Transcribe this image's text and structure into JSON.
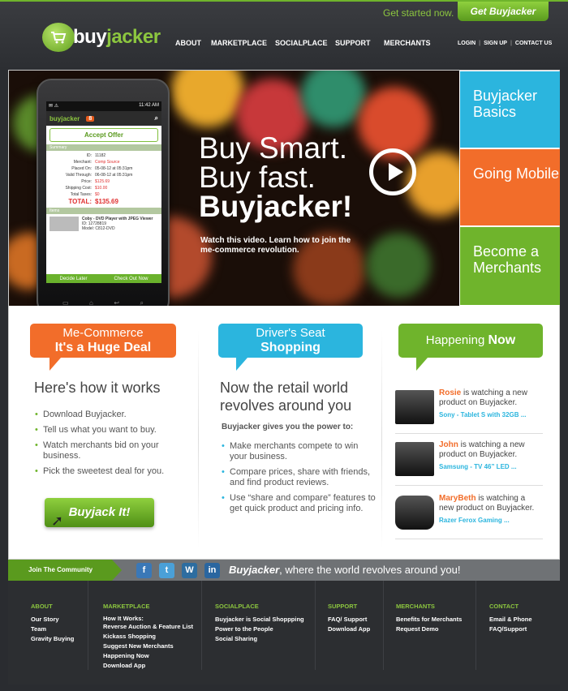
{
  "header": {
    "get_started": "Get started now.",
    "cta": "Get Buyjacker",
    "logo_part1": "buy",
    "logo_part2": "jacker",
    "nav": [
      "ABOUT",
      "MARKETPLACE",
      "SOCIALPLACE",
      "SUPPORT",
      "MERCHANTS"
    ],
    "util": [
      "LOGIN",
      "SIGN UP",
      "CONTACT US"
    ]
  },
  "hero": {
    "line1": "Buy Smart.",
    "line2": "Buy fast.",
    "line3": "Buyjacker!",
    "sub": "Watch this video. Learn how to join the me-commerce revolution."
  },
  "phone": {
    "time": "11:42 AM",
    "brand": "buyjacker",
    "badge": "8",
    "accept": "Accept Offer",
    "summary_label": "Summary",
    "rows": [
      {
        "k": "ID:",
        "v": "11182"
      },
      {
        "k": "Merchant:",
        "v": "Comp Source"
      },
      {
        "k": "Placed On:",
        "v": "05-08-12 at 05:31pm"
      },
      {
        "k": "Valid Through:",
        "v": "06-08-12 at 05:31pm"
      },
      {
        "k": "Price:",
        "v": "$125.69"
      },
      {
        "k": "Shipping Cost:",
        "v": "$10.00"
      },
      {
        "k": "Total Taxes:",
        "v": "$0"
      }
    ],
    "total_label": "TOTAL:",
    "total": "$135.69",
    "items_label": "Items",
    "item_name": "Coby - DVD Player with JPEG Viewer",
    "item_id": "ID: 12728819",
    "item_model": "Model: C812-DVD",
    "decide": "Decide Later",
    "checkout": "Check Out Now"
  },
  "side": [
    "Buyjacker Basics",
    "Going Mobile",
    "Become a Merchants"
  ],
  "col1": {
    "b1": "Me-Commerce",
    "b2": "It's a Huge Deal",
    "heading": "Here's how it works",
    "items": [
      "Download Buyjacker.",
      "Tell us what you want to buy.",
      "Watch merchants bid on your business.",
      "Pick the sweetest deal for you."
    ],
    "button": "Buyjack It!"
  },
  "col2": {
    "b1": "Driver's Seat",
    "b2": "Shopping",
    "heading": "Now the retail world revolves around you",
    "power": "Buyjacker gives you the power to:",
    "items": [
      "Make merchants compete to win your business.",
      "Compare prices, share with friends, and find product reviews.",
      "Use “share and compare” features to get quick product and pricing info."
    ]
  },
  "col3": {
    "b1": "Happening",
    "b2": "Now",
    "items": [
      {
        "name": "Rosie",
        "text": "is watching a new product on Buyjacker.",
        "product": "Sony - Tablet S with 32GB ..."
      },
      {
        "name": "John",
        "text": "is watching a new product on Buyjacker.",
        "product": "Samsung - TV 46” LED ..."
      },
      {
        "name": "MaryBeth",
        "text": "is watching a new product on Buyjacker.",
        "product": "Razer Ferox Gaming ..."
      }
    ]
  },
  "community": {
    "join": "Join The Community",
    "slogan_brand": "Buyjacker",
    "slogan_rest": ", where the world revolves around you!"
  },
  "footer": [
    {
      "title": "ABOUT",
      "links": [
        "Our Story",
        "Team",
        "Gravity Buying"
      ]
    },
    {
      "title": "MARKETPLACE",
      "links": [
        "How It Works:",
        "Reverse Auction & Feature List",
        "Kickass Shopping",
        "Suggest New Merchants",
        "Happening Now",
        "Download App"
      ]
    },
    {
      "title": "SOCIALPLACE",
      "links": [
        "Buyjacker is Social Shoppping",
        "Power to the People",
        "Social Sharing"
      ]
    },
    {
      "title": "SUPPORT",
      "links": [
        "FAQ/ Support",
        "Download App"
      ]
    },
    {
      "title": "MERCHANTS",
      "links": [
        "Benefits for Merchants",
        "Request Demo"
      ]
    },
    {
      "title": "CONTACT",
      "links": [
        "Email & Phone",
        "FAQ/Support"
      ]
    }
  ]
}
